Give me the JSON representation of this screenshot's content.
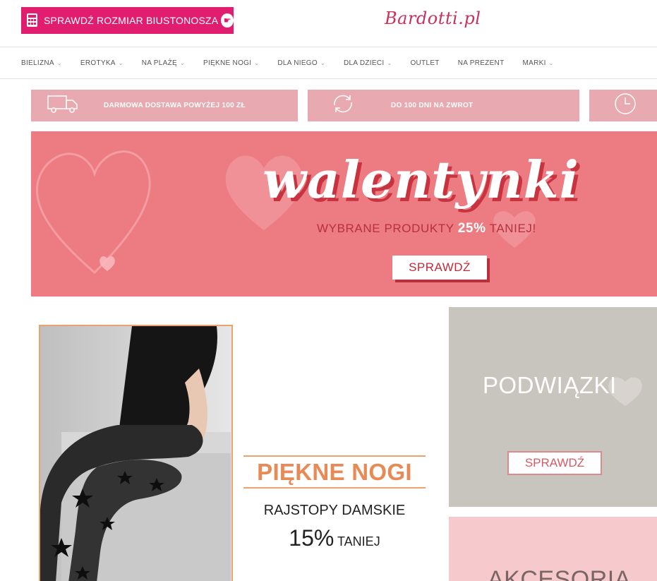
{
  "header": {
    "size_button_label": "SPRAWDŹ ROZMIAR BIUSTONOSZA",
    "logo_text": "Bardotti.pl"
  },
  "nav": {
    "items": [
      {
        "label": "BIELIZNA",
        "has_dropdown": true
      },
      {
        "label": "EROTYKA",
        "has_dropdown": true
      },
      {
        "label": "NA PLAŻĘ",
        "has_dropdown": true
      },
      {
        "label": "PIĘKNE NOGI",
        "has_dropdown": true
      },
      {
        "label": "DLA NIEGO",
        "has_dropdown": true
      },
      {
        "label": "DLA DZIECI",
        "has_dropdown": true
      },
      {
        "label": "OUTLET",
        "has_dropdown": false
      },
      {
        "label": "NA PREZENT",
        "has_dropdown": false
      },
      {
        "label": "MARKI",
        "has_dropdown": true
      }
    ],
    "chevron": "⌄"
  },
  "benefits": {
    "delivery": {
      "text": "DARMOWA DOSTAWA POWYŻEJ 100 ZŁ",
      "icon": "truck-icon"
    },
    "returns": {
      "text": "DO 100 DNI NA ZWROT",
      "icon": "refresh-icon"
    },
    "time": {
      "icon": "clock-icon"
    }
  },
  "hero": {
    "headline": "walentynki",
    "promo_prefix": "WYBRANE PRODUKTY ",
    "promo_highlight": "25%",
    "promo_suffix": " TANIEJ!",
    "cta": "SPRAWDŹ",
    "background": "#ed7b82"
  },
  "legs_banner": {
    "title": "PIĘKNE NOGI",
    "subtitle": "RAJSTOPY DAMSKIE",
    "percent": "15%",
    "percent_suffix": " TANIEJ",
    "accent": "#e88a55"
  },
  "tiles": {
    "garters": {
      "title": "PODWIĄZKI",
      "cta": "SPRAWDŹ"
    },
    "accessories": {
      "title": "AKCESORIA"
    }
  },
  "colors": {
    "brand_pink": "#e01d6e",
    "benefit_bg": "#e8aab0",
    "logo": "#c8325a"
  }
}
